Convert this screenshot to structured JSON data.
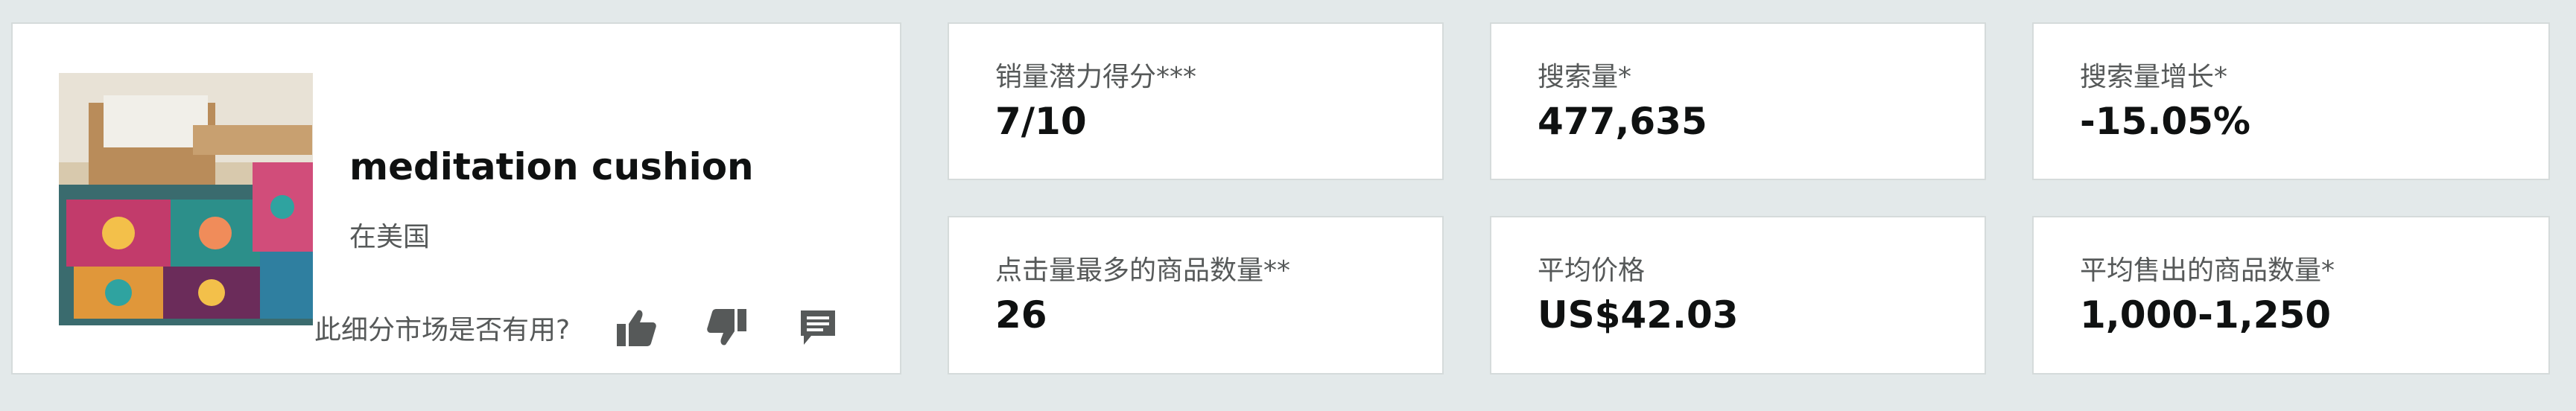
{
  "product": {
    "title": "meditation cushion",
    "marketplace": "在美国",
    "image_alt": "meditation cushion product photo",
    "feedback_prompt": "此细分市场是否有用?",
    "feedback_icons": [
      "thumbs-up-icon",
      "thumbs-down-icon",
      "comment-icon"
    ]
  },
  "metrics": [
    {
      "label": "销量潜力得分***",
      "value": "7/10"
    },
    {
      "label": "搜索量*",
      "value": "477,635"
    },
    {
      "label": "搜索量增长*",
      "value": "-15.05%"
    },
    {
      "label": "点击量最多的商品数量**",
      "value": "26"
    },
    {
      "label": "平均价格",
      "value": "US$42.03"
    },
    {
      "label": "平均售出的商品数量*",
      "value": "1,000-1,250"
    }
  ],
  "colors": {
    "background": "#e3e9ea",
    "card": "#ffffff",
    "card_border": "#d5dbdb",
    "primary_text": "#0f1111",
    "secondary_text": "#565959",
    "icon": "#565959"
  }
}
